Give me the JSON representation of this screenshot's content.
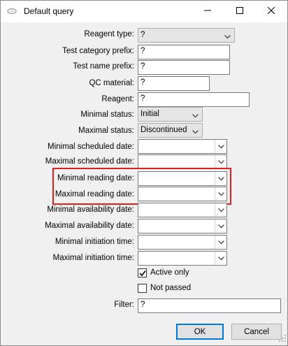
{
  "window": {
    "title": "Default query",
    "controls": {
      "minimize": "minimize",
      "maximize": "maximize",
      "close": "close"
    }
  },
  "form": {
    "reagent_type": {
      "label": "Reagent type:",
      "value": "?"
    },
    "test_category_prefix": {
      "label": "Test category prefix:",
      "value": "?"
    },
    "test_name_prefix": {
      "label": "Test name prefix:",
      "value": "?"
    },
    "qc_material": {
      "label": "QC material:",
      "value": "?"
    },
    "reagent": {
      "label": "Reagent:",
      "value": "?"
    },
    "minimal_status": {
      "label": "Minimal status:",
      "value": "Initial"
    },
    "maximal_status": {
      "label": "Maximal status:",
      "value": "Discontinued"
    },
    "minimal_scheduled_date": {
      "label": "Minimal scheduled date:",
      "value": ""
    },
    "maximal_scheduled_date": {
      "label": "Maximal scheduled date:",
      "value": ""
    },
    "minimal_reading_date": {
      "label": "Minimal reading date:",
      "value": ""
    },
    "maximal_reading_date": {
      "label": "Maximal reading date:",
      "value": ""
    },
    "minimal_availability_date": {
      "label": "Minimal availability date:",
      "value": ""
    },
    "maximal_availability_date": {
      "label": "Maximal availability date:",
      "value": ""
    },
    "minimal_initiation_time": {
      "label": "Minimal initiation time:",
      "value": ""
    },
    "maximal_initiation_time": {
      "label": "Maximal initiation time:",
      "value": ""
    },
    "active_only": {
      "label": "Active only",
      "checked": true
    },
    "not_passed": {
      "label": "Not passed",
      "checked": false
    },
    "filter": {
      "label": "Filter:",
      "value": "?"
    }
  },
  "buttons": {
    "ok": "OK",
    "cancel": "Cancel"
  },
  "colors": {
    "highlight": "#e01e1e",
    "default_button": "#0078d7"
  },
  "icons": [
    "app-icon",
    "minimize-icon",
    "maximize-icon",
    "close-icon",
    "chevron-down-icon",
    "checkmark-icon",
    "resize-grip-icon"
  ]
}
